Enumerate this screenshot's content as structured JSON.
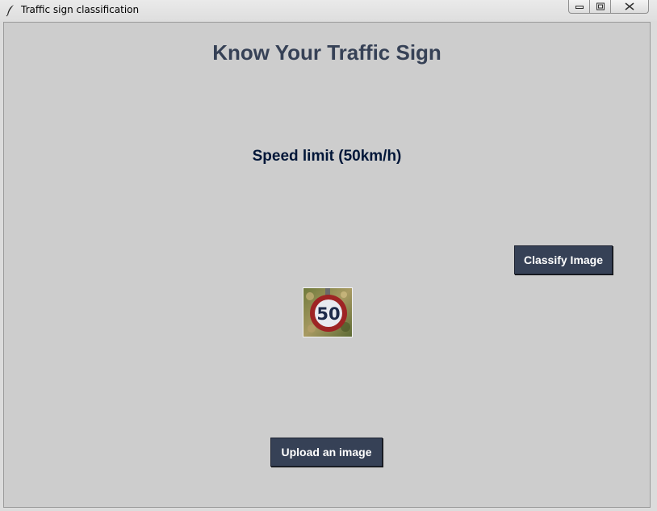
{
  "window": {
    "title": "Traffic sign classification"
  },
  "main": {
    "heading": "Know Your Traffic Sign",
    "prediction": "Speed limit (50km/h)",
    "classify_label": "Classify Image",
    "upload_label": "Upload an image",
    "uploaded_image": {
      "sign_text": "50"
    }
  },
  "colors": {
    "background": "#CDCDCD",
    "heading": "#364156",
    "prediction": "#011638",
    "button_bg": "#364156",
    "button_text": "#FFFFFF"
  },
  "icons": {
    "app": "feather-icon",
    "minimize": "minimize-icon",
    "maximize": "maximize-icon",
    "close": "close-icon"
  }
}
